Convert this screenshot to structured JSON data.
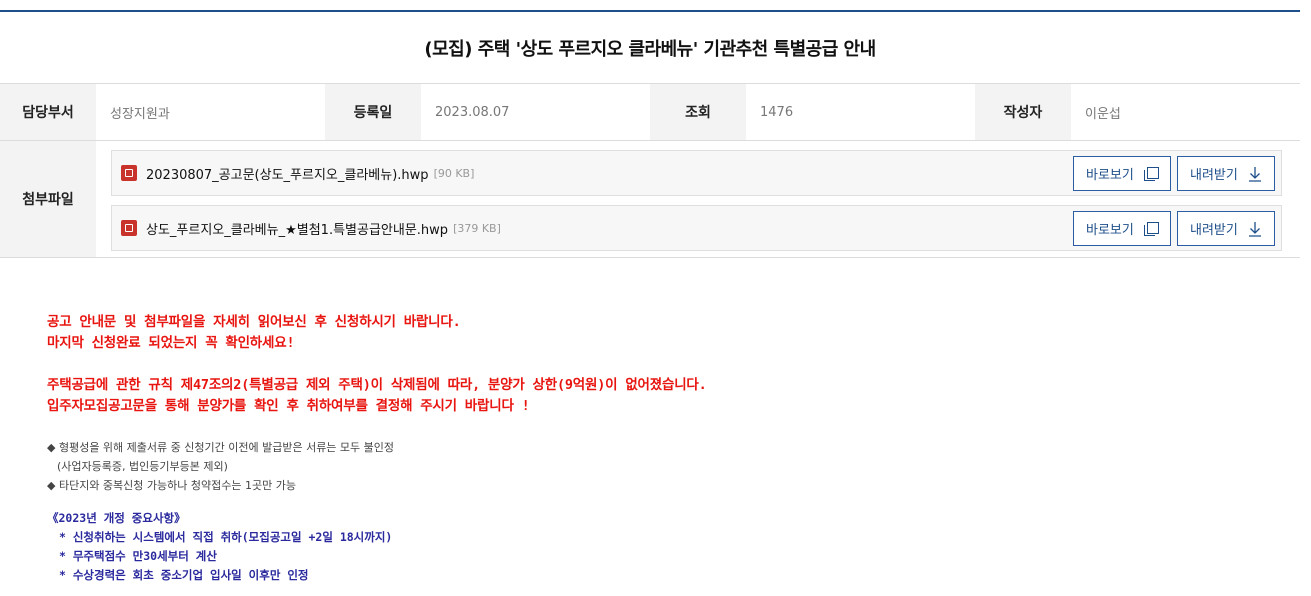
{
  "post": {
    "title": "(모집) 주택 '상도 푸르지오 클라베뉴' 기관추천 특별공급 안내"
  },
  "meta": {
    "dept_label": "담당부서",
    "dept_value": "성장지원과",
    "date_label": "등록일",
    "date_value": "2023.08.07",
    "views_label": "조회",
    "views_value": "1476",
    "author_label": "작성자",
    "author_value": "이운섭"
  },
  "attachments": {
    "label": "첨부파일",
    "view_label": "바로보기",
    "download_label": "내려받기",
    "files": [
      {
        "name": "20230807_공고문(상도_푸르지오_클라베뉴).hwp",
        "size": "[90 KB]"
      },
      {
        "name": "상도_푸르지오_클라베뉴_★별첨1.특별공급안내문.hwp",
        "size": "[379 KB]"
      }
    ]
  },
  "content": {
    "red_lines": [
      "공고 안내문 및 첨부파일을 자세히 읽어보신 후 신청하시기 바랍니다.",
      "마지막 신청완료 되었는지 꼭 확인하세요!",
      "주택공급에 관한 규칙 제47조의2(특별공급 제외 주택)이 삭제됨에 따라, 분양가 상한(9억원)이 없어졌습니다.",
      "입주자모집공고문을 통해 분양가를 확인 후 취하여부를 결정해 주시기 바랍니다 !"
    ],
    "small_lines": [
      "◆ 형평성을 위해 제출서류 중 신청기간 이전에 발급받은 서류는 모두 불인정",
      "(사업자등록증, 법인등기부등본 제외)",
      "◆ 타단지와 중복신청 가능하나 청약접수는 1곳만 가능"
    ],
    "blue_lines": [
      "《2023년 개정 중요사항》",
      "* 신청취하는 시스템에서 직접 취하(모집공고일 +2일 18시까지)",
      "* 무주택점수 만30세부터 계산",
      "* 수상경력은 회초 중소기업 입사일 이후만 인정"
    ]
  },
  "colors": {
    "accent": "#1e4f8a",
    "notice_red": "#e8140f",
    "notice_blue": "#2a2a9e",
    "label_bg": "#f3f3f3"
  }
}
